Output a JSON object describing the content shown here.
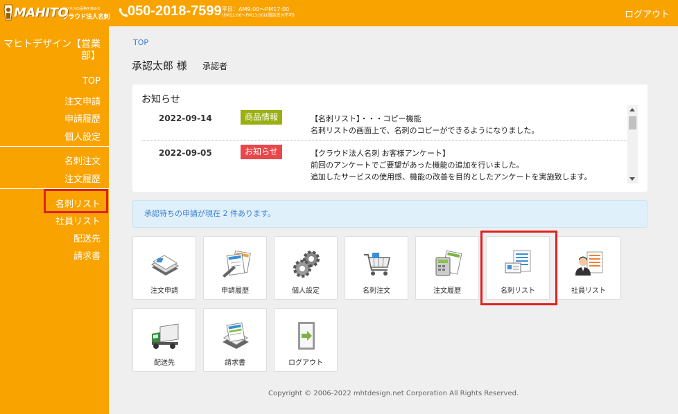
{
  "header": {
    "logo_main": "MAHITO",
    "logo_tagline": "ビジネスの品格を高める",
    "logo_sub": "クラウド法人名刺",
    "phone": "050-2018-7599",
    "hours_line1": "平日：AM9:00～PM17:00",
    "hours_line2": "(PM12:00～PM13:00は電話受付不可)",
    "logout": "ログアウト",
    "bg_color": "#f9a300"
  },
  "sidebar": {
    "company": "マヒトデザイン【営業部】",
    "items": [
      {
        "label": "TOP"
      },
      {
        "label": "注文申請"
      },
      {
        "label": "申請履歴"
      },
      {
        "label": "個人設定"
      },
      {
        "label": "名刺注文"
      },
      {
        "label": "注文履歴"
      },
      {
        "label": "名刺リスト"
      },
      {
        "label": "社員リスト"
      },
      {
        "label": "配送先"
      },
      {
        "label": "請求書"
      }
    ]
  },
  "main": {
    "breadcrumb": "TOP",
    "user_name": "承認太郎 様",
    "user_role": "承認者",
    "notice": {
      "title": "お知らせ",
      "items": [
        {
          "date": "2022-09-14",
          "badge": "商品情報",
          "badge_color": "#9aaf12",
          "lines": [
            "【名刺リスト】・・・コピー機能",
            "名刺リストの画面上で、名刺のコピーができるようになりました。"
          ]
        },
        {
          "date": "2022-09-05",
          "badge": "お知らせ",
          "badge_color": "#e8484b",
          "lines": [
            "【クラウド法人名刺 お客様アンケート】",
            "前回のアンケートでご要望があった機能の追加を行いました。",
            "追加したサービスの使用感、機能の改善を目的としたアンケートを実施致します。"
          ]
        }
      ]
    },
    "alert": "承認待ちの申請が現在 2 件あります。",
    "tiles": [
      {
        "label": "注文申請",
        "icon": "document-stack-icon"
      },
      {
        "label": "申請履歴",
        "icon": "documents-pen-icon"
      },
      {
        "label": "個人設定",
        "icon": "gears-icon"
      },
      {
        "label": "名刺注文",
        "icon": "cart-icon"
      },
      {
        "label": "注文履歴",
        "icon": "calculator-docs-icon"
      },
      {
        "label": "名刺リスト",
        "icon": "cards-list-icon"
      },
      {
        "label": "社員リスト",
        "icon": "employee-list-icon"
      },
      {
        "label": "配送先",
        "icon": "truck-icon"
      },
      {
        "label": "請求書",
        "icon": "invoice-icon"
      },
      {
        "label": "ログアウト",
        "icon": "exit-door-icon"
      }
    ]
  },
  "footer": {
    "copyright": "Copyright © 2006-2022 mhtdesign.net Corporation All Rights Reserved."
  }
}
